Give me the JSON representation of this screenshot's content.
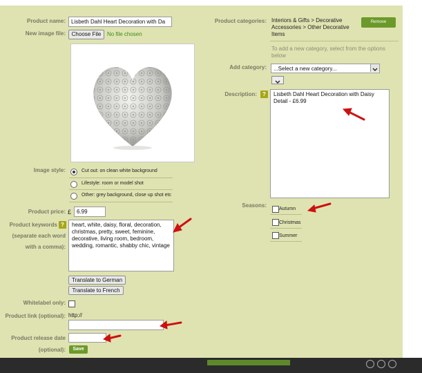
{
  "form": {
    "product_name_label": "Product name:",
    "product_name_value": "Lisbeth Dahl Heart Decoration with Da",
    "new_image_label": "New image file:",
    "choose_file_label": "Choose File",
    "no_file_text": "No file chosen",
    "image_style_label": "Image style:",
    "image_style_options": [
      "Cut out: on clean white background",
      "Lifestyle: room or model shot",
      "Other: grey background, close up shot etc"
    ],
    "image_style_selected": 0,
    "price_label": "Product price:",
    "currency": "£",
    "price_value": "6.99",
    "keywords_label_line1": "Product keywords",
    "keywords_label_line2": "(separate each word",
    "keywords_label_line3": "with a comma):",
    "keywords_value": "heart, white, daisy, floral, decoration, christmas, pretty, sweet, feminine, decorative, living room, bedroom, wedding, romantic, shabby chic, vintage",
    "translate_german": "Translate to German",
    "translate_french": "Translate to French",
    "whitelabel_label": "Whitelabel only:",
    "product_link_label": "Product link (optional):",
    "product_link_prefix": "http://",
    "release_date_label_line1": "Product release date",
    "release_date_label_line2": "(optional):",
    "save_label": "Save",
    "categories_label": "Product categories:",
    "categories_value": "Interiors & Gifts > Decorative Accessories > Other Decorative Items",
    "remove_label": "Remove",
    "add_category_hint": "To add a new category, select from the options below",
    "add_category_label": "Add category:",
    "add_category_placeholder": "...Select a new category...",
    "description_label": "Description:",
    "description_value": "Lisbeth Dahl Heart Decoration with Daisy Detail - £6.99",
    "seasons_label": "Seasons:",
    "seasons": [
      "Autumn",
      "Christmas",
      "Summer"
    ],
    "help_glyph": "?"
  },
  "colors": {
    "panel": "#dfe3b1",
    "accent_green": "#6b9a2a",
    "arrow_red": "#cc1111"
  }
}
